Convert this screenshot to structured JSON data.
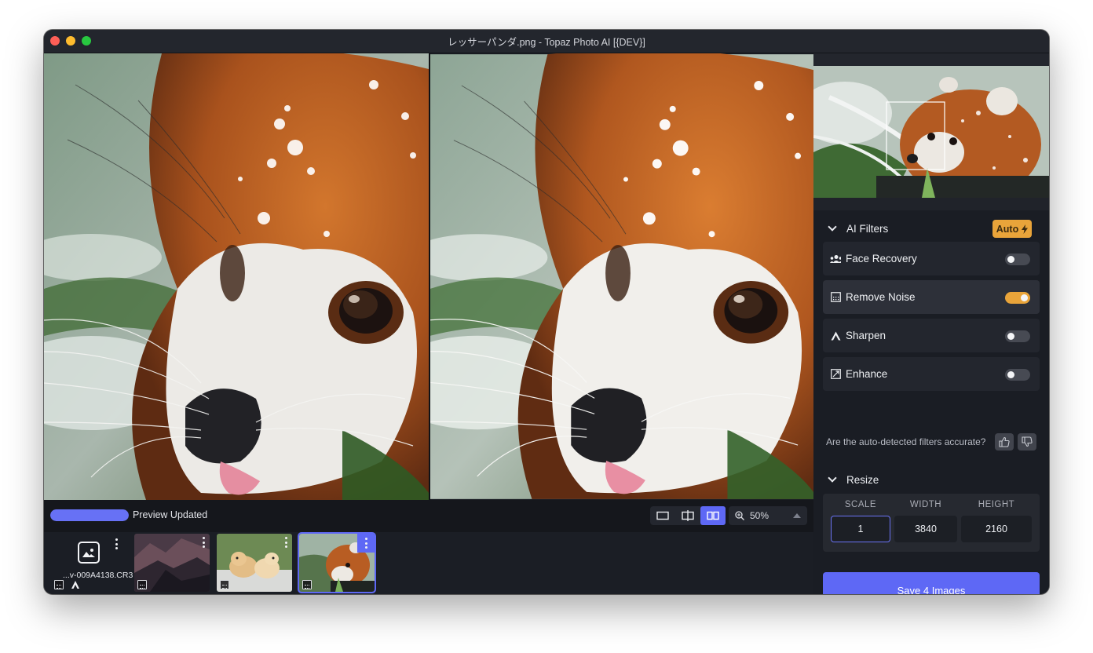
{
  "window": {
    "title": "レッサーパンダ.png - Topaz Photo AI [{DEV}]"
  },
  "viewer": {
    "status_text": "Preview Updated",
    "progress": 1.0,
    "view_modes": [
      "single-view-icon",
      "split-view-icon",
      "side-by-side-icon"
    ],
    "active_view_mode": "side-by-side-icon",
    "zoom": "50%"
  },
  "filmstrip": {
    "add_tile_name": "...v-009A4138.CR3",
    "thumbnails": [
      {
        "subject": "mountain landscape"
      },
      {
        "subject": "two puppies"
      },
      {
        "subject": "red panda",
        "selected": true
      }
    ]
  },
  "sidebar": {
    "ai_filters": {
      "title": "AI Filters",
      "auto_label": "Auto",
      "filters": [
        {
          "label": "Face Recovery",
          "icon": "face-recovery-icon",
          "enabled": false
        },
        {
          "label": "Remove Noise",
          "icon": "remove-noise-icon",
          "enabled": true
        },
        {
          "label": "Sharpen",
          "icon": "sharpen-icon",
          "enabled": false
        },
        {
          "label": "Enhance",
          "icon": "enhance-icon",
          "enabled": false
        }
      ],
      "feedback_question": "Are the auto-detected filters accurate?"
    },
    "resize": {
      "title": "Resize",
      "headers": {
        "scale": "SCALE",
        "width": "WIDTH",
        "height": "HEIGHT"
      },
      "values": {
        "scale": "1",
        "width": "3840",
        "height": "2160"
      }
    },
    "save_label": "Save 4 Images"
  },
  "colors": {
    "accent": "#5e68f5",
    "auto_orange": "#e9a43a",
    "panel_bg": "#1a1d24"
  }
}
